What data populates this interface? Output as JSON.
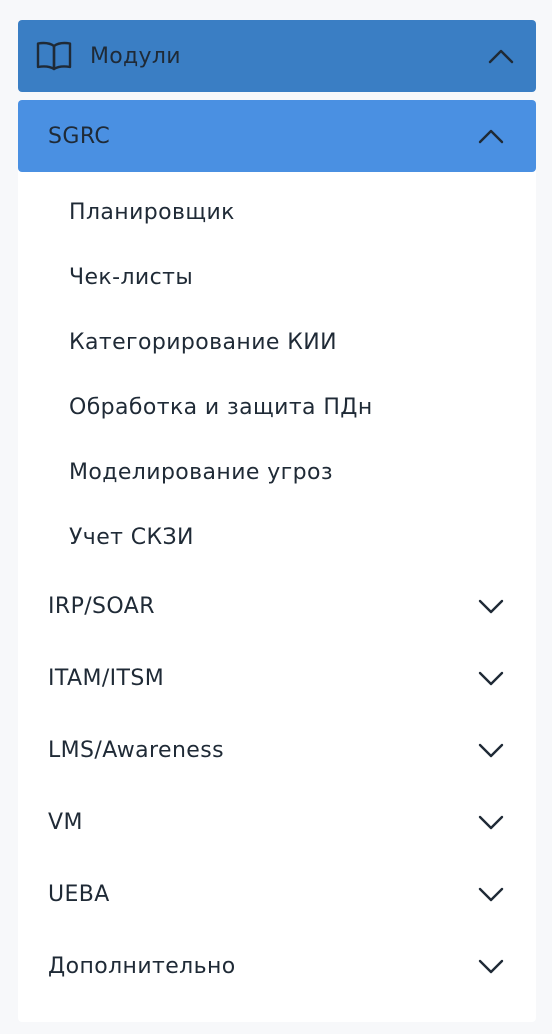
{
  "colors": {
    "header_bg": "#3a7ec4",
    "subheader_bg": "#4a90e2",
    "text": "#1f2a36",
    "panel_bg": "#ffffff",
    "page_bg": "#f7f8fa"
  },
  "menu": {
    "title": "Модули",
    "title_icon": "book-open-icon",
    "expanded_section": {
      "label": "SGRC",
      "items": [
        {
          "label": "Планировщик"
        },
        {
          "label": "Чек-листы"
        },
        {
          "label": "Категорирование КИИ"
        },
        {
          "label": "Обработка и защита ПДн"
        },
        {
          "label": "Моделирование угроз"
        },
        {
          "label": "Учет СКЗИ"
        }
      ]
    },
    "collapsed_sections": [
      {
        "label": "IRP/SOAR"
      },
      {
        "label": "ITAM/ITSM"
      },
      {
        "label": "LMS/Awareness"
      },
      {
        "label": "VM"
      },
      {
        "label": "UEBA"
      },
      {
        "label": "Дополнительно"
      }
    ]
  }
}
